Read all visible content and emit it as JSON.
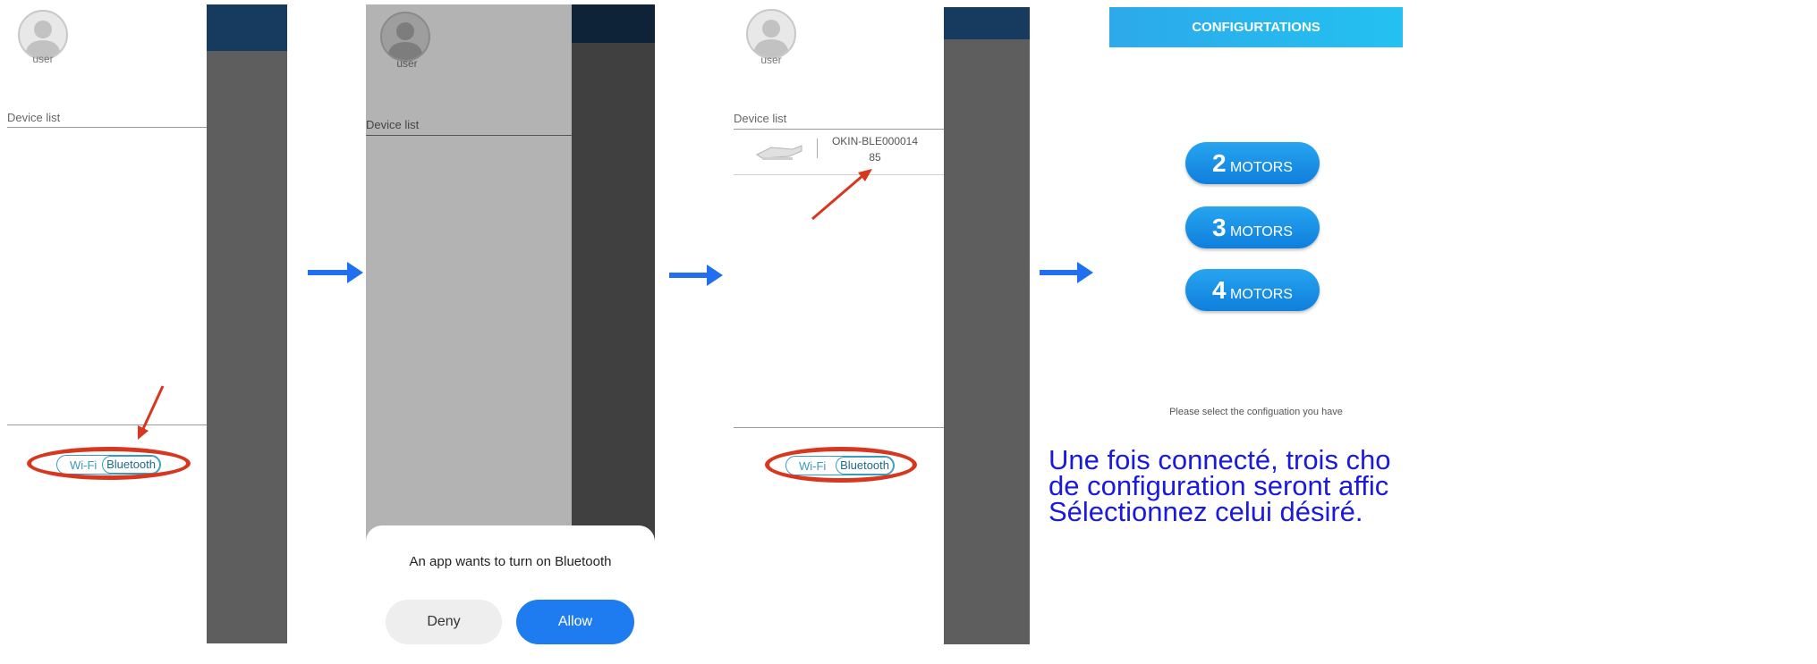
{
  "panel1": {
    "user_label": "user",
    "device_list_label": "Device list",
    "toggle": {
      "wifi": "Wi-Fi",
      "bluetooth": "Bluetooth"
    }
  },
  "panel2": {
    "user_label": "user",
    "device_list_label": "Device list",
    "dialog": {
      "title": "An app wants to turn on Bluetooth",
      "deny": "Deny",
      "allow": "Allow"
    }
  },
  "panel3": {
    "user_label": "user",
    "device_list_label": "Device list",
    "device": {
      "name_line1": "OKIN-BLE000014",
      "name_line2": "85"
    },
    "toggle": {
      "wifi": "Wi-Fi",
      "bluetooth": "Bluetooth"
    }
  },
  "panel4": {
    "header": "CONFIGURTATIONS",
    "options": [
      {
        "number": "2",
        "label": "MOTORS"
      },
      {
        "number": "3",
        "label": "MOTORS"
      },
      {
        "number": "4",
        "label": "MOTORS"
      }
    ],
    "hint": "Please select the configuation you have",
    "caption": [
      "Une fois connecté, trois cho",
      "de configuration seront affic",
      "Sélectionnez celui désiré."
    ]
  },
  "colors": {
    "annotation_red": "#d7361f",
    "arrow_blue": "#1f6ff0",
    "header_navy": "#173a5f",
    "motor_blue": "#1e8ef0",
    "caption_blue": "#1a1adf"
  }
}
